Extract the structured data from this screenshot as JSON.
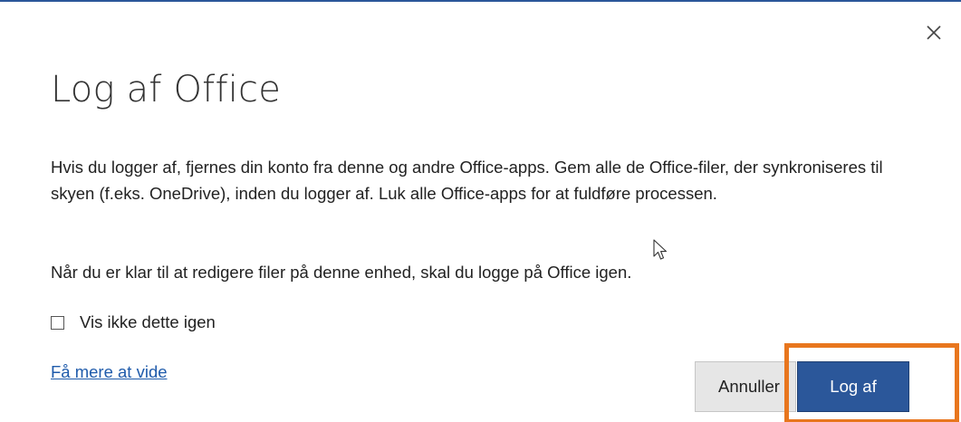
{
  "dialog": {
    "title": "Log af Office",
    "close_icon": "close-icon",
    "paragraph1": "Hvis du logger af, fjernes din konto fra denne og andre Office-apps. Gem alle de Office-filer, der synkroniseres til skyen (f.eks. OneDrive), inden du logger af. Luk alle Office-apps for at fuldføre processen.",
    "paragraph2": "Når du er klar til at redigere filer på denne enhed, skal du logge på Office igen.",
    "checkbox_label": "Vis ikke dette igen",
    "checkbox_checked": false,
    "learn_more_link": "Få mere at vide",
    "cancel_label": "Annuller",
    "signout_label": "Log af",
    "accent_color": "#2b579a",
    "highlight_color": "#e8761e"
  }
}
